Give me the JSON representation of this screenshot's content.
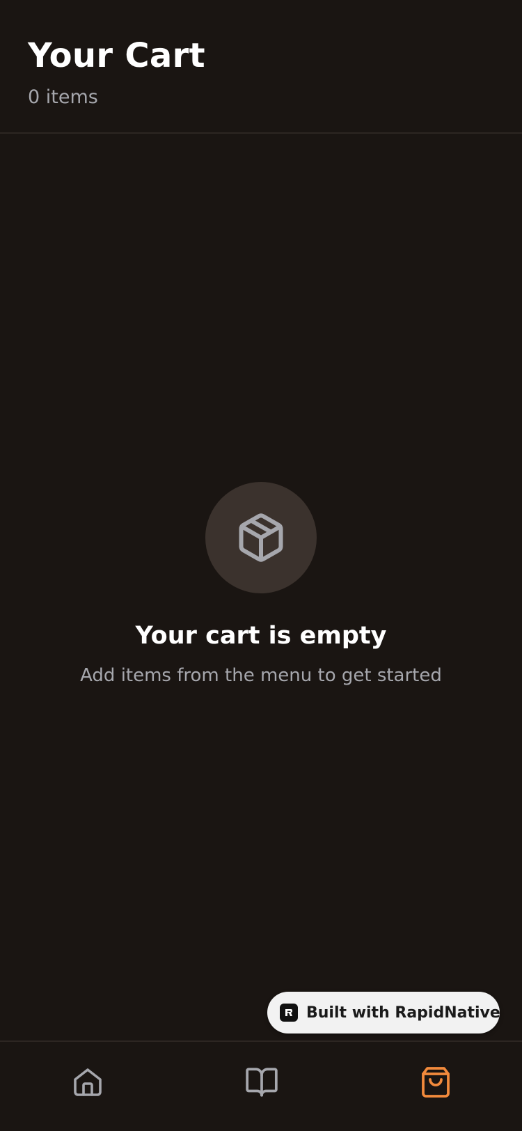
{
  "header": {
    "title": "Your Cart",
    "item_count": "0 items"
  },
  "empty_state": {
    "icon": "package-icon",
    "title": "Your cart is empty",
    "subtitle": "Add items from the menu to get started"
  },
  "badge": {
    "label": "Built with RapidNative",
    "logo_icon": "rapidnative-logo-icon"
  },
  "tab_bar": {
    "tabs": [
      {
        "name": "home",
        "icon": "home-icon",
        "active": false
      },
      {
        "name": "menu",
        "icon": "book-open-icon",
        "active": false
      },
      {
        "name": "cart",
        "icon": "shopping-bag-icon",
        "active": true
      }
    ]
  },
  "colors": {
    "background": "#1a1512",
    "divider": "#2d2622",
    "icon_circle": "#3b322d",
    "muted_text": "#a6a7ad",
    "accent": "#f28a3c",
    "inactive_icon": "#a6a7ad",
    "badge_bg": "#f2f2f2"
  }
}
